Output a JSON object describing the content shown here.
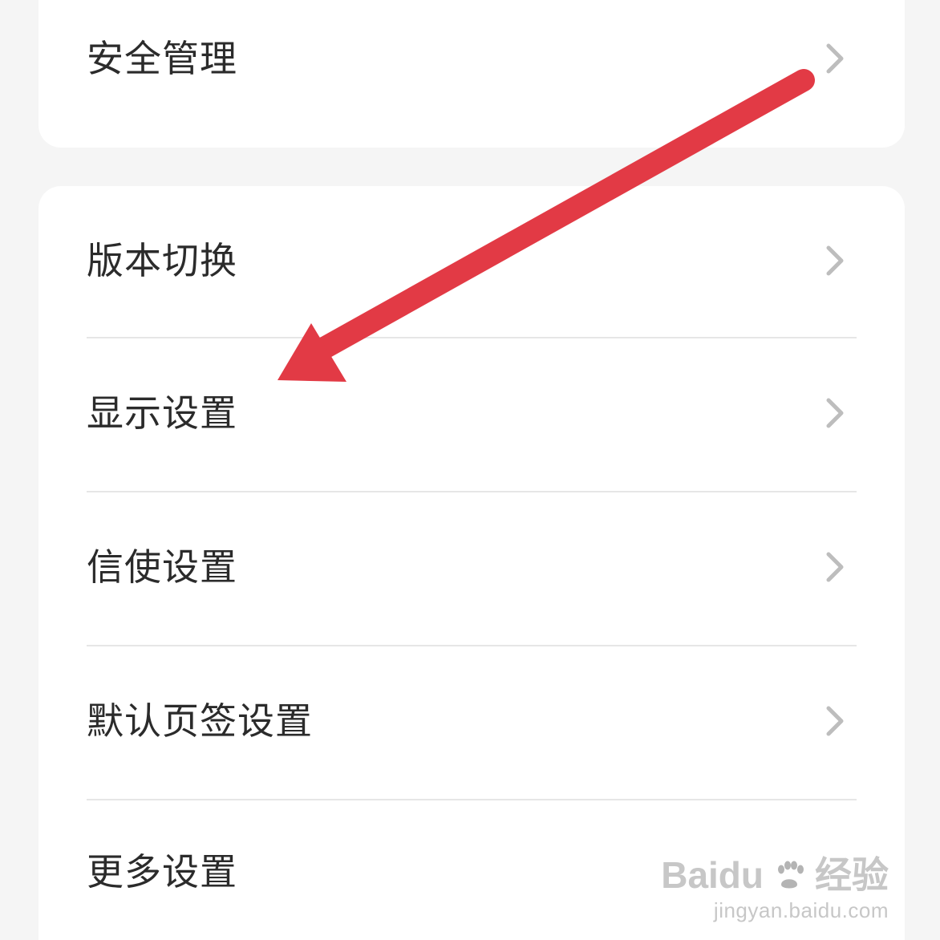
{
  "colors": {
    "page_background": "#f5f5f5",
    "card_background": "#ffffff",
    "label_text": "#2b2b2b",
    "chevron": "#bdbdbd",
    "divider": "#e6e6e6",
    "annotation_arrow": "#e23a45",
    "watermark": "#b4b4b4"
  },
  "icons": {
    "chevron": "chevron-right-icon",
    "annotation": "annotation-arrow-icon",
    "watermark_paw": "paw-icon"
  },
  "top_card": {
    "items": [
      {
        "label": "安全管理"
      }
    ]
  },
  "main_card": {
    "items": [
      {
        "label": "版本切换"
      },
      {
        "label": "显示设置"
      },
      {
        "label": "信使设置"
      },
      {
        "label": "默认页签设置"
      },
      {
        "label": "更多设置"
      }
    ]
  },
  "watermark": {
    "brand": "Baidu",
    "cn": "经验",
    "url": "jingyan.baidu.com"
  }
}
